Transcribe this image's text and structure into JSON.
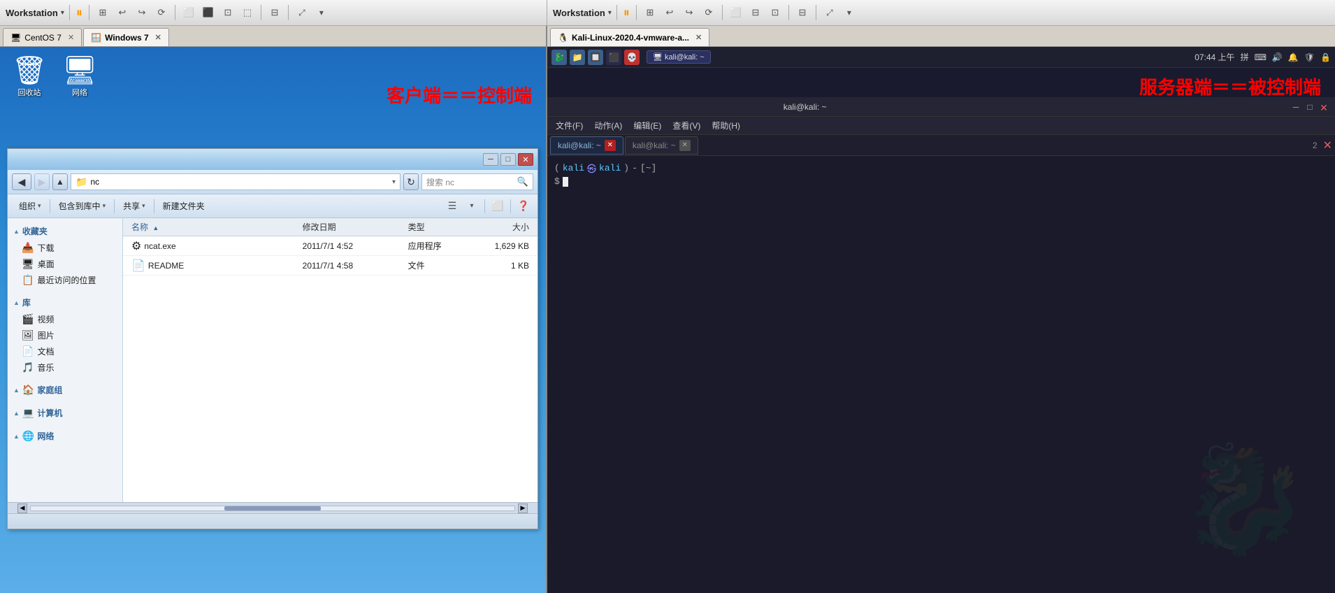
{
  "left": {
    "workstation_label": "Workstation",
    "tabs": [
      {
        "label": "CentOS 7",
        "active": false,
        "icon": "🖥"
      },
      {
        "label": "Windows 7",
        "active": true,
        "icon": "🪟"
      }
    ],
    "desktop_label": "客户端＝＝控制端",
    "explorer": {
      "title": "nc",
      "address": "nc",
      "search_placeholder": "搜索 nc",
      "toolbar_btns": [
        "组织",
        "包含到库中",
        "共享",
        "新建文件夹"
      ],
      "columns": [
        "名称",
        "修改日期",
        "类型",
        "大小"
      ],
      "files": [
        {
          "name": "ncat.exe",
          "date": "2011/7/1 4:52",
          "type": "应用程序",
          "size": "1,629 KB",
          "icon": "⚙"
        },
        {
          "name": "README",
          "date": "2011/7/1 4:58",
          "type": "文件",
          "size": "1 KB",
          "icon": "📄"
        }
      ],
      "sidebar": {
        "section1": "收藏夹",
        "items1": [
          "下载",
          "桌面",
          "最近访问的位置"
        ],
        "section2": "库",
        "items2": [
          "视频",
          "图片",
          "文档",
          "音乐"
        ],
        "section3": "家庭组",
        "section4": "计算机",
        "section5": "网络"
      }
    }
  },
  "right": {
    "workstation_label": "Workstation",
    "tabs": [
      {
        "label": "Kali-Linux-2020.4-vmware-a...",
        "active": true
      }
    ],
    "kali_label": "服务器端＝＝被控制端",
    "panel": {
      "time": "07:44 上午",
      "lang": "拼"
    },
    "terminal": {
      "title": "kali@kali: ~",
      "tabs": [
        {
          "label": "kali@kali: ~",
          "active": true
        },
        {
          "label": "kali@kali: ~",
          "active": false
        }
      ],
      "prompt": {
        "prefix": "(kali㉿kali)",
        "path": "-[~]",
        "dollar": "$"
      },
      "tab_num": "2"
    },
    "menubar": [
      "文件(F)",
      "动作(A)",
      "编辑(E)",
      "查看(V)",
      "帮助(H)"
    ]
  },
  "icons": {
    "back": "◀",
    "forward": "▶",
    "up": "▲",
    "refresh": "↻",
    "close": "✕",
    "minimize": "─",
    "maximize": "□",
    "pause": "⏸",
    "search": "🔍",
    "folder": "📁",
    "home": "🏠",
    "desktop": "🖥",
    "recycle": "🗑",
    "network": "🌐",
    "computer": "💻",
    "arrow_down": "▾",
    "chevron_right": "›"
  }
}
